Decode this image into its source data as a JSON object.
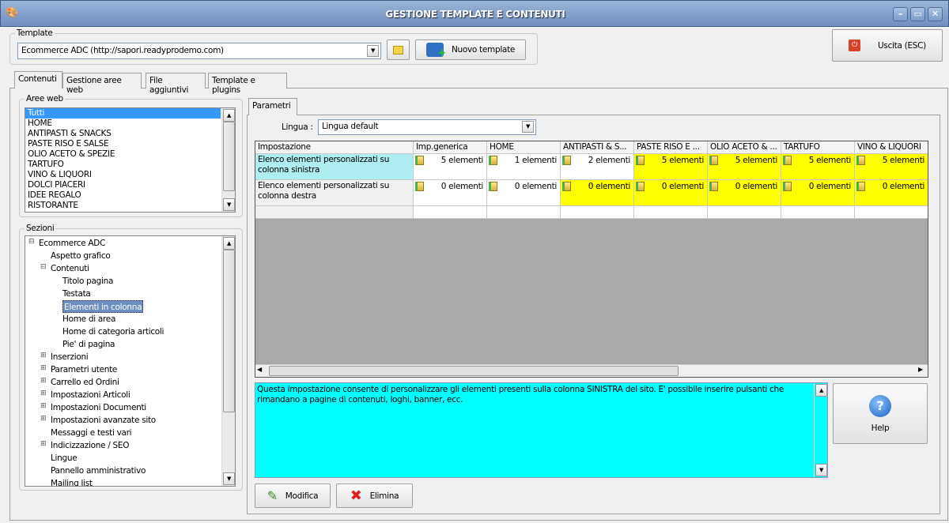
{
  "window": {
    "title": "GESTIONE TEMPLATE E CONTENUTI",
    "minimize": "–",
    "maximize": "▭",
    "close": "✕"
  },
  "template": {
    "group_label": "Template",
    "selected": "Ecommerce ADC (http://sapori.readyprodemo.com)",
    "new_label": "Nuovo template"
  },
  "exit_label": "Uscita (ESC)",
  "tabs": [
    "Contenuti",
    "Gestione aree web",
    "File aggiuntivi",
    "Template e plugins"
  ],
  "aree_web": {
    "label": "Aree web",
    "items": [
      "Tutti",
      "HOME",
      "ANTIPASTI & SNACKS",
      "PASTE RISO E SALSE",
      "OLIO ACETO & SPEZIE",
      "TARTUFO",
      "VINO & LIQUORI",
      "DOLCI PIACERI",
      "IDEE REGALO",
      "RISTORANTE"
    ]
  },
  "sezioni": {
    "label": "Sezioni",
    "items": [
      {
        "label": "Ecommerce ADC",
        "level": 0,
        "toggle": "−"
      },
      {
        "label": "Aspetto grafico",
        "level": 1,
        "toggle": ""
      },
      {
        "label": "Contenuti",
        "level": 1,
        "toggle": "−"
      },
      {
        "label": "Titolo pagina",
        "level": 2,
        "toggle": ""
      },
      {
        "label": "Testata",
        "level": 2,
        "toggle": ""
      },
      {
        "label": "Elementi in colonna",
        "level": 2,
        "toggle": "",
        "selected": true
      },
      {
        "label": "Home di area",
        "level": 2,
        "toggle": ""
      },
      {
        "label": "Home di categoria articoli",
        "level": 2,
        "toggle": ""
      },
      {
        "label": "Pie' di pagina",
        "level": 2,
        "toggle": ""
      },
      {
        "label": "Inserzioni",
        "level": 1,
        "toggle": "+"
      },
      {
        "label": "Parametri utente",
        "level": 1,
        "toggle": "+"
      },
      {
        "label": "Carrello ed Ordini",
        "level": 1,
        "toggle": "+"
      },
      {
        "label": "Impostazioni Articoli",
        "level": 1,
        "toggle": "+"
      },
      {
        "label": "Impostazioni Documenti",
        "level": 1,
        "toggle": "+"
      },
      {
        "label": "Impostazioni avanzate sito",
        "level": 1,
        "toggle": "+"
      },
      {
        "label": "Messaggi e testi vari",
        "level": 1,
        "toggle": ""
      },
      {
        "label": "Indicizzazione / SEO",
        "level": 1,
        "toggle": "+"
      },
      {
        "label": "Lingue",
        "level": 1,
        "toggle": ""
      },
      {
        "label": "Pannello amministrativo",
        "level": 1,
        "toggle": ""
      },
      {
        "label": "Mailing list",
        "level": 1,
        "toggle": ""
      }
    ]
  },
  "parametri": {
    "tab": "Parametri",
    "lingua_label": "Lingua :",
    "lingua_value": "Lingua default"
  },
  "grid": {
    "columns": [
      "Impostazione",
      "Imp.generica",
      "HOME",
      "ANTIPASTI & S...",
      "PASTE RISO E ...",
      "OLIO ACETO & ...",
      "TARTUFO",
      "VINO & LIQUORI"
    ],
    "rows": [
      {
        "label": "Elenco elementi personalizzati su colonna sinistra",
        "values": [
          "5 elementi",
          "1 elementi",
          "2 elementi",
          "5 elementi",
          "5 elementi",
          "5 elementi",
          "5 elementi"
        ],
        "highlighted": [
          false,
          false,
          false,
          true,
          true,
          true,
          true
        ]
      },
      {
        "label": "Elenco elementi personalizzati su colonna destra",
        "values": [
          "0 elementi",
          "0 elementi",
          "0 elementi",
          "0 elementi",
          "0 elementi",
          "0 elementi",
          "0 elementi"
        ],
        "highlighted": [
          false,
          false,
          true,
          true,
          true,
          true,
          true
        ]
      }
    ]
  },
  "description": "Questa impostazione consente di personalizzare gli elementi presenti sulla colonna SINISTRA del sito. E' possibile inserire pulsanti che rimandano a pagine di contenuti, loghi, banner, ecc.",
  "help_label": "Help",
  "modifica_label": "Modifica",
  "elimina_label": "Elimina",
  "colors": {
    "highlight": "#ffff00",
    "selected_row": "#aeeef0",
    "description_bg": "#00ffff"
  }
}
